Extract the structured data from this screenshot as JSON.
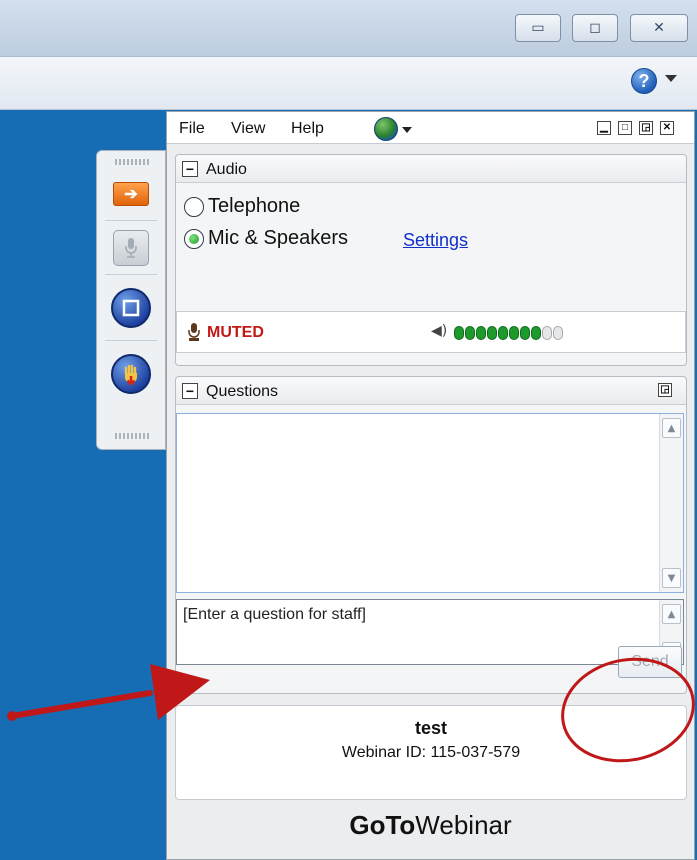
{
  "window": {
    "minimize_glyph": "▭",
    "maximize_glyph": "◻",
    "close_glyph": "✕",
    "help_glyph": "?"
  },
  "menu": {
    "file": "File",
    "view": "View",
    "help": "Help"
  },
  "panel_buttons": [
    "▁",
    "□",
    "◲",
    "✕"
  ],
  "audio": {
    "section_title": "Audio",
    "collapse_glyph": "−",
    "options": [
      {
        "label": "Telephone",
        "selected": false
      },
      {
        "label": "Mic & Speakers",
        "selected": true
      }
    ],
    "settings_link": "Settings",
    "mic_status": "MUTED",
    "speaker_glyph": "◀)",
    "level": {
      "filled": 8,
      "total": 10
    }
  },
  "questions": {
    "section_title": "Questions",
    "collapse_glyph": "−",
    "popout_glyph": "◲",
    "input_text": "[Enter a question for staff]",
    "send_label": "Send",
    "scroll_up": "▲",
    "scroll_down": "▼"
  },
  "webinar": {
    "title": "test",
    "id_text": "Webinar ID: 115-037-579"
  },
  "brand": {
    "bold": "GoTo",
    "light": "Webinar"
  },
  "colors": {
    "desktop": "#176db3",
    "muted": "#c31818",
    "link": "#1030c8",
    "annotation": "#c01818"
  }
}
